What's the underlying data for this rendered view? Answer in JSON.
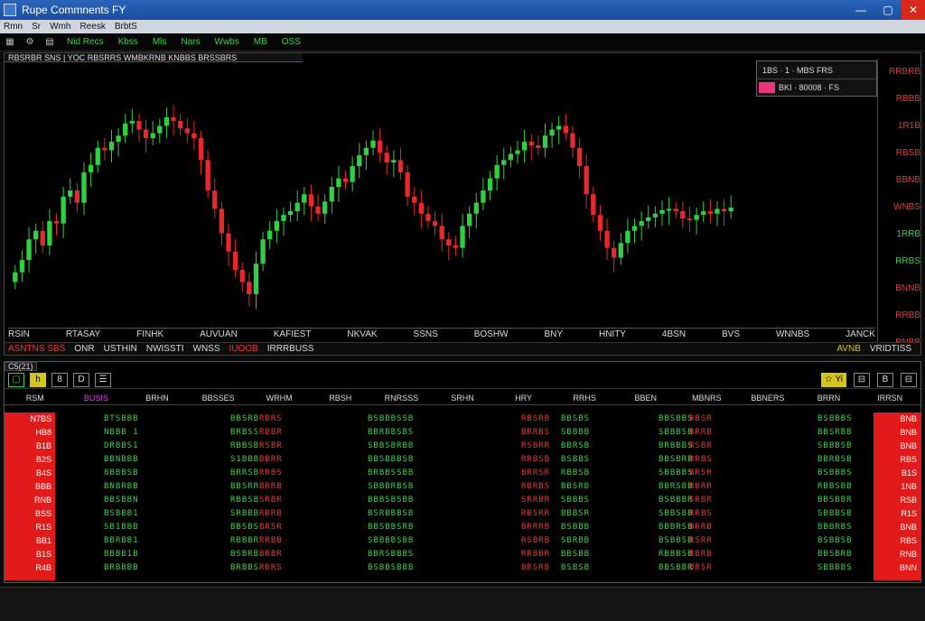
{
  "window": {
    "title": "Rupe Commnents FY",
    "minimize": "—",
    "maximize": "▢",
    "close": "✕"
  },
  "menu": [
    "Rmn",
    "Sr",
    "Wmh",
    "Reesk",
    "BrbtS"
  ],
  "toolbar": {
    "icons": [
      "grid-icon",
      "settings-icon",
      "chart-icon"
    ],
    "items": [
      "Nid Recs",
      "Kbss",
      "Mls",
      "Nars",
      "Wwbs",
      "MB",
      "OSS"
    ]
  },
  "chart": {
    "header": "RBSRBR SNS | YOC RBSRRS WMBKRNB KNBBS BRSSBRS",
    "info_box": {
      "row1": "1BS · 1 · MBS FRS",
      "row2": "BKI  ·  80008  ·  FS"
    },
    "price_labels": [
      "RRBRB",
      "RBBB",
      "1R1B",
      "RBSB",
      "BBNB",
      "WNBS",
      "1RRB",
      "RRBS",
      "BNNB",
      "RRBB",
      "RNBB"
    ],
    "time_labels": [
      "RSIN",
      "RTASAY",
      "FINHK",
      "AUVUAN",
      "KAFIEST",
      "NKVAK",
      "SSNS",
      "BOSHW",
      "BNY",
      "HNITY",
      "4BSN",
      "BVS",
      "WNNBS",
      "JANCK"
    ],
    "status": [
      "ASNTNS SBS",
      "ONR",
      "USTHIN",
      "NWISSTI",
      "WNSS",
      "IUOOB",
      "IRRRBUSS"
    ],
    "status_right": [
      "AVNB",
      "VRIDTISS"
    ],
    "candle_colors": {
      "up": "#2fd143",
      "down": "#e8282a"
    },
    "series_close": [
      148,
      158,
      175,
      182,
      170,
      190,
      188,
      210,
      215,
      205,
      230,
      236,
      250,
      248,
      255,
      260,
      270,
      272,
      265,
      258,
      262,
      268,
      275,
      272,
      266,
      262,
      258,
      240,
      215,
      200,
      180,
      165,
      150,
      140,
      130,
      155,
      175,
      182,
      190,
      195,
      198,
      205,
      212,
      202,
      196,
      206,
      218,
      225,
      222,
      235,
      244,
      250,
      256,
      246,
      238,
      240,
      230,
      210,
      205,
      196,
      190,
      186,
      175,
      170,
      168,
      186,
      196,
      205,
      215,
      225,
      236,
      240,
      245,
      248,
      255,
      252,
      250,
      260,
      265,
      268,
      262,
      250,
      235,
      212,
      195,
      182,
      168,
      160,
      172,
      182,
      186,
      190,
      193,
      196,
      199,
      200,
      198,
      192,
      191,
      195,
      198,
      196,
      200,
      198,
      201
    ]
  },
  "table": {
    "caption": "C5(21)",
    "toolbar_buttons": [
      "▢",
      "h",
      "8",
      "D",
      "☰"
    ],
    "toolbar_right": [
      "☆ Yi",
      "⊟",
      "B",
      "⊟"
    ],
    "headers": [
      "RSM",
      "BUSIS",
      "BRHN",
      "BBSSES",
      "WRHM",
      "RBSH",
      "RNRSSS",
      "SRHN",
      "HRY",
      "RRHS",
      "BBEN",
      "MBNRS",
      "BBNERS",
      "BRRN",
      "IRRSN"
    ],
    "left_col": [
      "N7BS",
      "HB8",
      "B1B",
      "B2S",
      "B4S",
      "BBB",
      "RNB",
      "BSS",
      "R1S",
      "BB1",
      "B1S",
      "R4B"
    ],
    "right_col": [
      "BNB",
      "BNB",
      "BNB",
      "RBS",
      "B1S",
      "1NB",
      "RSB",
      "R1S",
      "BNB",
      "RBS",
      "RNB",
      "BNN"
    ],
    "blocks": [
      {
        "color": "green",
        "lines": [
          "BTSBBB",
          "NBBB 1",
          "DRBBS1",
          "BBNBBB",
          "8BBBSB",
          "BNBRBB",
          "BBSBBN",
          "BSBBB1",
          "SB1BBB",
          "BBRBB1",
          "BBBB1B",
          "BRBBBB"
        ]
      },
      {
        "color": "green",
        "lines": [
          "BBSRB",
          "BRBSS",
          "RBBSB",
          "S1BBB",
          "BRRSB",
          "BBSRR",
          "RBBSB",
          "SRBBB",
          "BBSBS",
          "RBBBR",
          "BSBRB",
          "BRBBS"
        ]
      },
      {
        "color": "red",
        "lines": [
          "RBRS",
          "RBBR",
          "RSBR",
          "BBRR",
          "RRBS",
          "BRRB",
          "SRBR",
          "RBRB",
          "BRSR",
          "RRBB",
          "BRBR",
          "RBRS"
        ]
      },
      {
        "color": "green",
        "lines": [
          "BSBBBSSB",
          "BBRBBSBS",
          "SBBSBRBB",
          "BBSBBBSB",
          "BRBBSSBB",
          "SBBBRBSB",
          "BBBSBSBB",
          "BSRBBBSB",
          "BBSBBSRB",
          "SBBBBSBB",
          "BBRSBBBS",
          "BSBBSBBB"
        ]
      },
      {
        "color": "red",
        "lines": [
          "RBSRB",
          "BRRBS",
          "RSBRR",
          "RRBSB",
          "BRRSR",
          "RBRBS",
          "SRRBR",
          "RBSRR",
          "BRRRB",
          "RSBRB",
          "RRBBR",
          "BRSRB"
        ]
      },
      {
        "color": "green",
        "lines": [
          "BBSBS",
          "SBBBB",
          "BBRSB",
          "BSBBS",
          "RBBSB",
          "BBSRB",
          "SBBBS",
          "BBBSR",
          "BSBBB",
          "SBRBB",
          "BBSBB",
          "BSBSB"
        ]
      },
      {
        "color": "green",
        "lines": [
          "BBSBBS",
          "SBBBSB",
          "BRBBBS",
          "BBSBRB",
          "SBBBBS",
          "BBRSBB",
          "BSBBBR",
          "SBBSBB",
          "BBBRSB",
          "BSBBSB",
          "RBBBSB",
          "BBSBBR"
        ]
      },
      {
        "color": "red",
        "lines": [
          "RBSR",
          "BRRB",
          "RSBR",
          "RRBS",
          "BRSR",
          "RBRR",
          "SRBR",
          "RRBS",
          "BRRB",
          "RSRR",
          "RBRB",
          "BRSR"
        ]
      },
      {
        "color": "green",
        "lines": [
          "BSBBBS",
          "BBSRBB",
          "SBBBSB",
          "BBRBSB",
          "BSBBBS",
          "RBBSBB",
          "BBSBBR",
          "SBBBSB",
          "BBBRBS",
          "BSBBSB",
          "BBSBRB",
          "SBBBBS"
        ]
      }
    ]
  }
}
